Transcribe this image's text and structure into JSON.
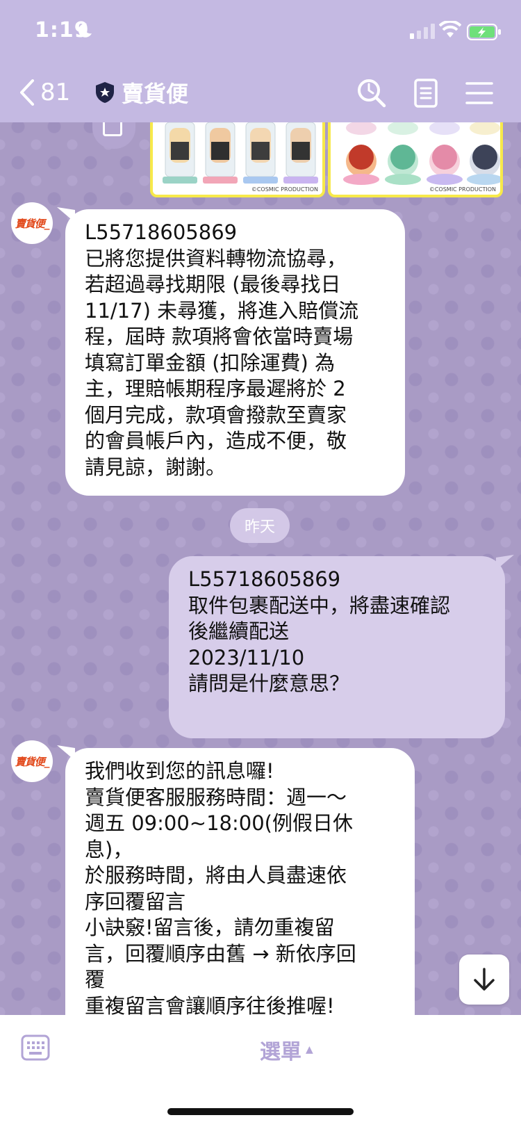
{
  "status_bar": {
    "time": "1:19"
  },
  "nav": {
    "back_count": "81",
    "title": "賣貨便"
  },
  "images": {
    "copyright_left": "©COSMIC PRODUCTION",
    "copyright_right": "©COSMIC PRODUCTION"
  },
  "avatar_label": "賣貨便_",
  "messages": {
    "incoming_1": {
      "lines": [
        "L55718605869",
        "已將您提供資料轉物流協尋，",
        "若超過尋找期限 (最後尋找日",
        "11/17) 未尋獲，將進入賠償流",
        "程，屆時 款項將會依當時賣場",
        "填寫訂單金額 (扣除運費) 為",
        "主，理賠帳期程序最遲將於 2",
        "個月完成，款項會撥款至賣家",
        "的會員帳戶內，造成不便，敬",
        "請見諒，謝謝。"
      ]
    },
    "date_separator": "昨天",
    "outgoing_1": {
      "lines": [
        "L55718605869",
        "取件包裹配送中，將盡速確認",
        "後繼續配送",
        "2023/11/10",
        "請問是什麼意思？"
      ]
    },
    "incoming_2": {
      "lines": [
        "我們收到您的訊息囉!",
        "賣貨便客服服務時間：週一～",
        "週五 09:00~18:00(例假日休",
        "息)，",
        "於服務時間，將由人員盡速依",
        "序回覆留言",
        "小訣竅!留言後，請勿重複留",
        "言，回覆順序由舊 → 新依序回",
        "覆",
        "重複留言會讓順序往後推喔!"
      ]
    }
  },
  "bottom_bar": {
    "menu_label": "選單"
  },
  "colors": {
    "header": "#c4b9e2",
    "chat_bg": "#a99bc5",
    "bubble_out": "#d7cdea",
    "menu_text": "#b2a4d6"
  }
}
